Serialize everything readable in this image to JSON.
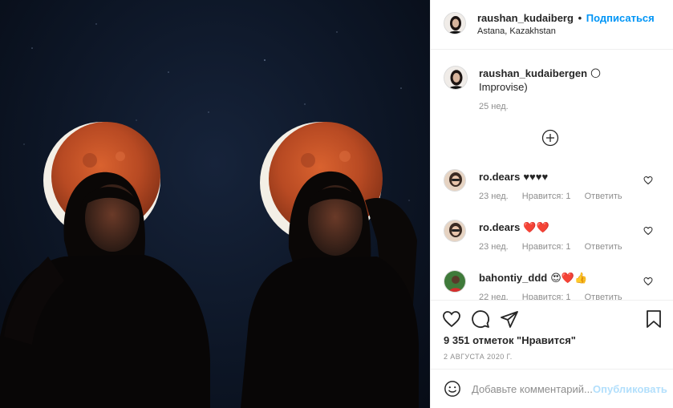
{
  "header": {
    "username": "raushan_kudaiberg",
    "separator": "•",
    "follow_label": "Подписаться",
    "location": "Astana, Kazakhstan",
    "more_icon": "more-horizontal-icon"
  },
  "caption": {
    "username": "raushan_kudaibergen",
    "emoji": "🌕",
    "text": "Improvise)",
    "time": "25 нед."
  },
  "load_more_icon": "plus-circle-icon",
  "comments": [
    {
      "username": "ro.dears",
      "text": "♥♥♥♥",
      "time": "23 нед.",
      "likes": "Нравится: 1",
      "reply": "Ответить"
    },
    {
      "username": "ro.dears",
      "text": "❤️❤️",
      "time": "23 нед.",
      "likes": "Нравится: 1",
      "reply": "Ответить"
    },
    {
      "username": "bahontiy_ddd",
      "text": "😍❤️👍",
      "time": "22 нед.",
      "likes": "Нравится: 1",
      "reply": "Ответить"
    }
  ],
  "actions": {
    "likes_text": "9 351 отметок \"Нравится\"",
    "date": "2 АВГУСТА 2020 Г.",
    "icons": [
      "heart-icon",
      "comment-icon",
      "share-icon",
      "bookmark-icon"
    ]
  },
  "add_comment": {
    "placeholder": "Добавьте комментарий...",
    "publish_label": "Опубликовать"
  },
  "colors": {
    "accent": "#0095f6",
    "publish_disabled": "#b2dffc",
    "moon": "#c9552a",
    "night_sky": "#0d1626"
  }
}
